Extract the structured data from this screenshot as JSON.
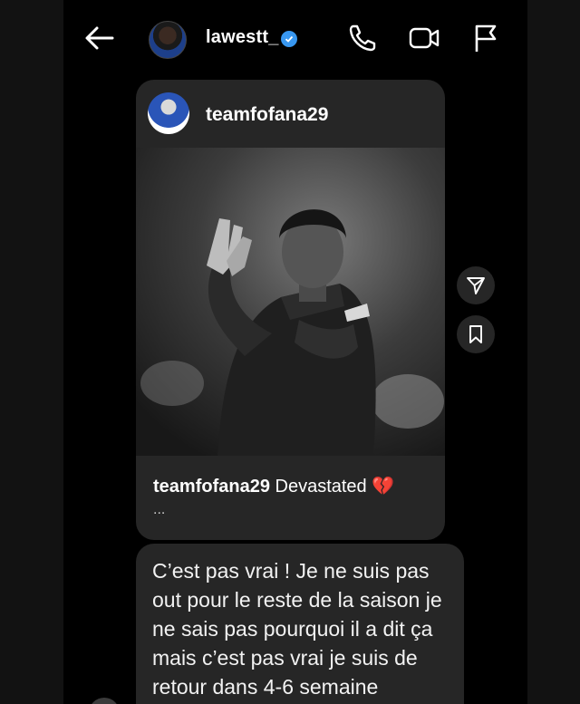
{
  "header": {
    "username": "lawestt_",
    "icons": {
      "back": "arrow-left-icon",
      "verified": "verified-badge-icon",
      "call": "phone-icon",
      "video": "video-camera-icon",
      "flag": "flag-icon"
    }
  },
  "shared_post": {
    "author": "teamfofana29",
    "caption_user": "teamfofana29",
    "caption_text": "Devastated 💔",
    "more": "..."
  },
  "side_actions": {
    "share_icon": "send-icon",
    "save_icon": "bookmark-icon"
  },
  "message": {
    "text": "C’est pas vrai ! Je ne suis pas out pour le reste de la saison je ne sais pas pourquoi il a dit ça mais c’est pas vrai je suis de retour dans 4-6 semaine"
  },
  "colors": {
    "background": "#000000",
    "bubble": "#262626",
    "verified": "#3897f0"
  }
}
